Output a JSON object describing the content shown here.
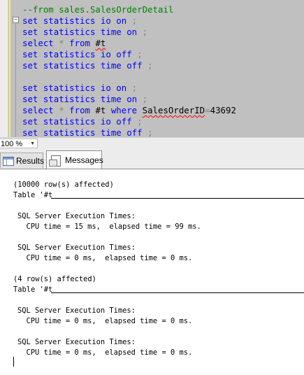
{
  "editor": {
    "lines": [
      [
        {
          "c": "cm",
          "t": "--from sales.SalesOrderDetail"
        }
      ],
      [
        {
          "c": "kw",
          "t": "set statistics io on"
        },
        {
          "c": "op",
          "t": " ;"
        }
      ],
      [
        {
          "c": "kw",
          "t": "set statistics time on"
        },
        {
          "c": "op",
          "t": " ;"
        }
      ],
      [
        {
          "c": "kw",
          "t": "select"
        },
        {
          "c": "op",
          "t": " * "
        },
        {
          "c": "kw",
          "t": "from"
        },
        {
          "c": "tx",
          "t": " "
        },
        {
          "c": "tx sq",
          "t": "#t"
        }
      ],
      [
        {
          "c": "kw",
          "t": "set statistics io off"
        },
        {
          "c": "op",
          "t": " ;"
        }
      ],
      [
        {
          "c": "kw",
          "t": "set statistics time off"
        },
        {
          "c": "op",
          "t": " ;"
        }
      ],
      [
        {
          "c": "tx",
          "t": ""
        }
      ],
      [
        {
          "c": "kw",
          "t": "set statistics io on"
        },
        {
          "c": "op",
          "t": " ;"
        }
      ],
      [
        {
          "c": "kw",
          "t": "set statistics time on"
        },
        {
          "c": "op",
          "t": " ;"
        }
      ],
      [
        {
          "c": "kw",
          "t": "select"
        },
        {
          "c": "op",
          "t": " * "
        },
        {
          "c": "kw",
          "t": "from"
        },
        {
          "c": "tx",
          "t": " #t "
        },
        {
          "c": "kw",
          "t": "where"
        },
        {
          "c": "tx",
          "t": " "
        },
        {
          "c": "tx sq",
          "t": "SalesOrderID"
        },
        {
          "c": "op",
          "t": "="
        },
        {
          "c": "tx",
          "t": "43692"
        }
      ],
      [
        {
          "c": "kw",
          "t": "set statistics io off"
        },
        {
          "c": "op",
          "t": " ;"
        }
      ],
      [
        {
          "c": "kw",
          "t": "set statistics time off"
        },
        {
          "c": "op",
          "t": " ;"
        }
      ]
    ]
  },
  "zoom": {
    "value": "100 %"
  },
  "tabs": {
    "results": "Results",
    "messages": "Messages"
  },
  "messages": [
    {
      "t": "(10000 row(s) affected)",
      "indent": 0
    },
    {
      "t": "Table '#t",
      "indent": 0,
      "rule": true
    },
    {
      "t": "",
      "indent": 0
    },
    {
      "t": "SQL Server Execution Times:",
      "indent": 1
    },
    {
      "t": "  CPU time = 15 ms,  elapsed time = 99 ms.",
      "indent": 1
    },
    {
      "t": "",
      "indent": 0
    },
    {
      "t": "SQL Server Execution Times:",
      "indent": 1
    },
    {
      "t": "  CPU time = 0 ms,  elapsed time = 0 ms.",
      "indent": 1
    },
    {
      "t": "",
      "indent": 0
    },
    {
      "t": "(4 row(s) affected)",
      "indent": 0
    },
    {
      "t": "Table '#t",
      "indent": 0,
      "rule": true
    },
    {
      "t": "",
      "indent": 0
    },
    {
      "t": "SQL Server Execution Times:",
      "indent": 1
    },
    {
      "t": "  CPU time = 0 ms,  elapsed time = 0 ms.",
      "indent": 1
    },
    {
      "t": "",
      "indent": 0
    },
    {
      "t": "SQL Server Execution Times:",
      "indent": 1
    },
    {
      "t": "  CPU time = 0 ms,  elapsed time = 0 ms.",
      "indent": 1
    }
  ]
}
